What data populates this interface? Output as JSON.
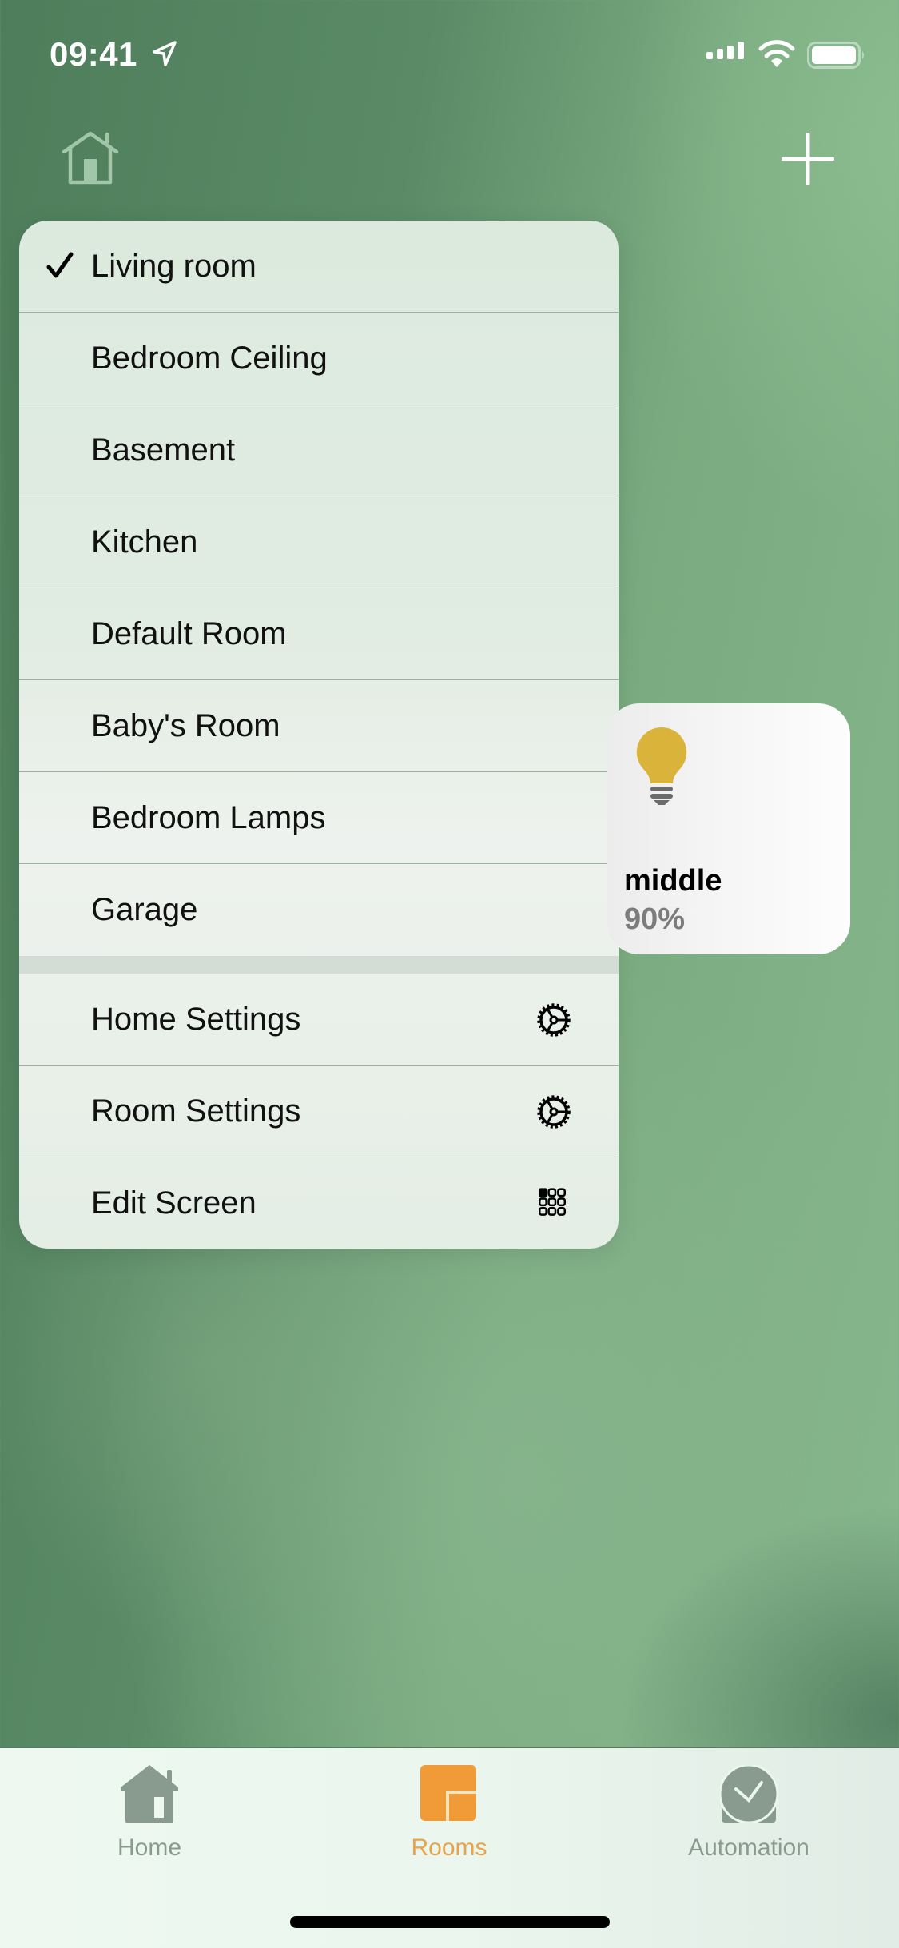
{
  "status_bar": {
    "time": "09:41",
    "icons": [
      "location-arrow-icon",
      "cellular-signal-icon",
      "wifi-icon",
      "battery-icon"
    ]
  },
  "nav": {
    "left_icon": "home-outline-icon",
    "right_icon": "plus-icon"
  },
  "menu": {
    "rooms": [
      {
        "label": "Living room",
        "selected": true
      },
      {
        "label": "Bedroom Ceiling",
        "selected": false
      },
      {
        "label": "Basement",
        "selected": false
      },
      {
        "label": "Kitchen",
        "selected": false
      },
      {
        "label": "Default Room",
        "selected": false
      },
      {
        "label": "Baby's Room",
        "selected": false
      },
      {
        "label": "Bedroom Lamps",
        "selected": false
      },
      {
        "label": "Garage",
        "selected": false
      }
    ],
    "actions": [
      {
        "label": "Home Settings",
        "icon": "gear-icon"
      },
      {
        "label": "Room Settings",
        "icon": "gear-icon"
      },
      {
        "label": "Edit Screen",
        "icon": "grid-icon"
      }
    ]
  },
  "accessory_tile": {
    "name": "middle",
    "value": "90%",
    "icon": "lightbulb-icon",
    "icon_color": "#dab33a"
  },
  "tab_bar": {
    "tabs": [
      {
        "label": "Home",
        "icon": "home-filled-icon",
        "active": false
      },
      {
        "label": "Rooms",
        "icon": "rooms-icon",
        "active": true
      },
      {
        "label": "Automation",
        "icon": "automation-clock-icon",
        "active": false
      }
    ],
    "active_color": "#f09a38",
    "inactive_color": "#899a8e"
  }
}
